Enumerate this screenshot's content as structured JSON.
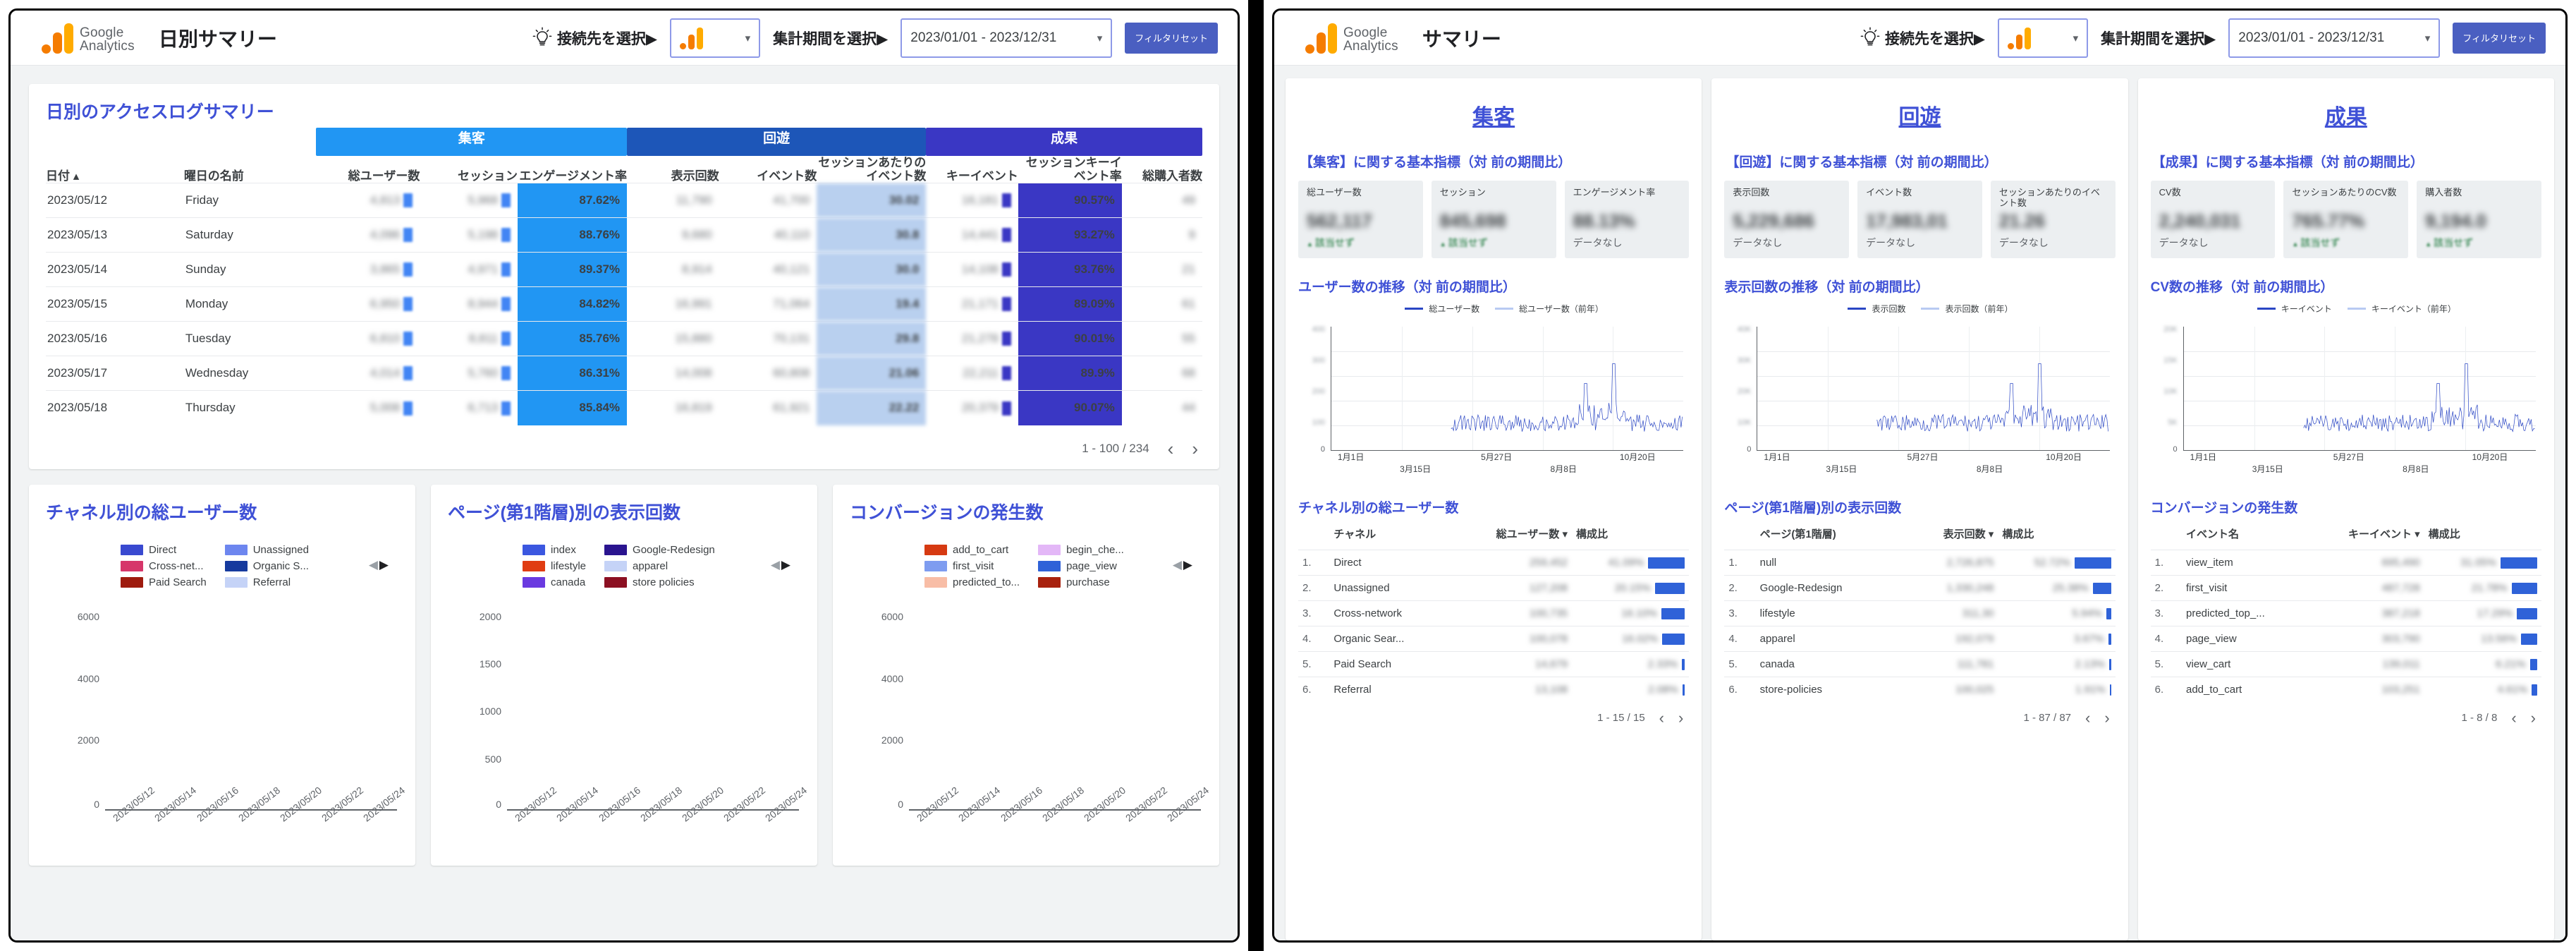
{
  "left": {
    "topbar": {
      "brand_line1": "Google",
      "brand_line2": "Analytics",
      "doc_title": "日別サマリー",
      "connect_label": "接続先を選択▶",
      "period_label": "集計期間を選択▶",
      "date_range": "2023/01/01 - 2023/12/31",
      "reset_label": "フィルタリセット",
      "dropdown_caret": "▾"
    },
    "table_card": {
      "title": "日別のアクセスログサマリー",
      "groups": [
        {
          "label": "集客",
          "color": "#2196f3",
          "span": 3
        },
        {
          "label": "回遊",
          "color": "#1d56b8",
          "span": 3
        },
        {
          "label": "成果",
          "color": "#3a37c4",
          "span": 3
        }
      ],
      "columns": [
        "日付 ▴",
        "曜日の名前",
        "総ユーザー数",
        "セッション",
        "エンゲージメント率",
        "表示回数",
        "イベント数",
        "セッションあたりのイベント数",
        "キーイベント",
        "セッションキーイベント率",
        "総購入者数"
      ],
      "rows": [
        {
          "date": "2023/05/12",
          "weekday": "Friday",
          "engagement": "87.62%",
          "event_per_session": "30.02",
          "key_event_rate": "90.57%"
        },
        {
          "date": "2023/05/13",
          "weekday": "Saturday",
          "engagement": "88.76%",
          "event_per_session": "30.8",
          "key_event_rate": "93.27%"
        },
        {
          "date": "2023/05/14",
          "weekday": "Sunday",
          "engagement": "89.37%",
          "event_per_session": "30.0",
          "key_event_rate": "93.76%"
        },
        {
          "date": "2023/05/15",
          "weekday": "Monday",
          "engagement": "84.82%",
          "event_per_session": "19.4",
          "key_event_rate": "89.09%"
        },
        {
          "date": "2023/05/16",
          "weekday": "Tuesday",
          "engagement": "85.76%",
          "event_per_session": "29.8",
          "key_event_rate": "90.01%"
        },
        {
          "date": "2023/05/17",
          "weekday": "Wednesday",
          "engagement": "86.31%",
          "event_per_session": "21.06",
          "key_event_rate": "89.9%"
        },
        {
          "date": "2023/05/18",
          "weekday": "Thursday",
          "engagement": "85.84%",
          "event_per_session": "22.22",
          "key_event_rate": "90.07%"
        }
      ],
      "pager": {
        "range": "1 - 100 / 234",
        "prev": "‹",
        "next": "›"
      }
    },
    "charts": [
      {
        "title": "チャネル別の総ユーザー数",
        "legend": [
          {
            "label": "Direct",
            "color": "#3949d0"
          },
          {
            "label": "Unassigned",
            "color": "#6d86ef"
          },
          {
            "label": "Cross-net...",
            "color": "#d6366a"
          },
          {
            "label": "Organic S...",
            "color": "#163a9e"
          },
          {
            "label": "Paid Search",
            "color": "#9e1b0e"
          },
          {
            "label": "Referral",
            "color": "#c5d3f7"
          }
        ],
        "yticks": [
          "6000",
          "4000",
          "2000",
          "0"
        ],
        "xlabels": [
          "2023/05/12",
          "2023/05/14",
          "2023/05/16",
          "2023/05/18",
          "2023/05/20",
          "2023/05/22",
          "2023/05/24"
        ]
      },
      {
        "title": "ページ(第1階層)別の表示回数",
        "legend": [
          {
            "label": "index",
            "color": "#3b57e0"
          },
          {
            "label": "Google-Redesign",
            "color": "#2a148f"
          },
          {
            "label": "lifestyle",
            "color": "#e03c12"
          },
          {
            "label": "apparel",
            "color": "#c5d3f7"
          },
          {
            "label": "canada",
            "color": "#6a3ae0"
          },
          {
            "label": "store policies",
            "color": "#8c1022"
          }
        ],
        "yticks": [
          "2000",
          "1500",
          "1000",
          "500",
          "0"
        ],
        "xlabels": [
          "2023/05/12",
          "2023/05/14",
          "2023/05/16",
          "2023/05/18",
          "2023/05/20",
          "2023/05/22",
          "2023/05/24"
        ]
      },
      {
        "title": "コンバージョンの発生数",
        "legend": [
          {
            "label": "add_to_cart",
            "color": "#d63a12"
          },
          {
            "label": "begin_che...",
            "color": "#e3b7f7"
          },
          {
            "label": "first_visit",
            "color": "#7e9cf0"
          },
          {
            "label": "page_view",
            "color": "#2f62d8"
          },
          {
            "label": "predicted_to...",
            "color": "#f8bda6"
          },
          {
            "label": "purchase",
            "color": "#a8210e"
          }
        ],
        "yticks": [
          "6000",
          "4000",
          "2000",
          "0"
        ],
        "xlabels": [
          "2023/05/12",
          "2023/05/14",
          "2023/05/16",
          "2023/05/18",
          "2023/05/20",
          "2023/05/22",
          "2023/05/24"
        ]
      }
    ],
    "legend_nav": {
      "left": "◀",
      "right": "▶"
    }
  },
  "right": {
    "topbar": {
      "brand_line1": "Google",
      "brand_line2": "Analytics",
      "doc_title": "サマリー",
      "connect_label": "接続先を選択▶",
      "period_label": "集計期間を選択▶",
      "date_range": "2023/01/01 - 2023/12/31",
      "reset_label": "フィルタリセット",
      "dropdown_caret": "▾"
    },
    "columns": [
      {
        "heading": "集客",
        "kpi_section_title": "【集客】に関する基本指標（対 前の期間比）",
        "kpis": [
          {
            "label": "総ユーザー数",
            "value": "562,117",
            "delta": "該当せず",
            "delta_kind": "up"
          },
          {
            "label": "セッション",
            "value": "845,698",
            "delta": "該当せず",
            "delta_kind": "up"
          },
          {
            "label": "エンゲージメント率",
            "value": "88.13%",
            "delta": "データなし",
            "delta_kind": "none"
          }
        ],
        "trend": {
          "title": "ユーザー数の推移（対 前の期間比）",
          "legend": [
            {
              "label": "総ユーザー数",
              "color": "#2a46c4"
            },
            {
              "label": "総ユーザー数（前年）",
              "color": "#b8caf2"
            }
          ],
          "yticks": [
            "400",
            "300",
            "200",
            "100",
            "0"
          ],
          "xlabels": [
            "1月1日",
            "3月15日",
            "5月27日",
            "8月8日",
            "10月20日"
          ]
        },
        "table": {
          "title": "チャネル別の総ユーザー数",
          "columns": [
            "チャネル",
            "総ユーザー数 ▾",
            "構成比"
          ],
          "rows": [
            {
              "idx": "1.",
              "name": "Direct",
              "value": "259,452",
              "pct": "41.09%",
              "bar": 100
            },
            {
              "idx": "2.",
              "name": "Unassigned",
              "value": "127,208",
              "pct": "20.15%",
              "bar": 82
            },
            {
              "idx": "3.",
              "name": "Cross-network",
              "value": "100,735",
              "pct": "16.10%",
              "bar": 64
            },
            {
              "idx": "4.",
              "name": "Organic Sear...",
              "value": "100,078",
              "pct": "16.02%",
              "bar": 62
            },
            {
              "idx": "5.",
              "name": "Paid Search",
              "value": "14,679",
              "pct": "2.33%",
              "bar": 8
            },
            {
              "idx": "6.",
              "name": "Referral",
              "value": "13,108",
              "pct": "2.08%",
              "bar": 7
            }
          ],
          "pager": {
            "range": "1 - 15 / 15",
            "prev": "‹",
            "next": "›"
          }
        }
      },
      {
        "heading": "回遊",
        "kpi_section_title": "【回遊】に関する基本指標（対 前の期間比）",
        "kpis": [
          {
            "label": "表示回数",
            "value": "5,229,686",
            "delta": "データなし",
            "delta_kind": "none"
          },
          {
            "label": "イベント数",
            "value": "17,983,01",
            "delta": "データなし",
            "delta_kind": "none"
          },
          {
            "label": "セッションあたりのイベント数",
            "value": "21.26",
            "delta": "データなし",
            "delta_kind": "none"
          }
        ],
        "trend": {
          "title": "表示回数の推移（対 前の期間比）",
          "legend": [
            {
              "label": "表示回数",
              "color": "#2a46c4"
            },
            {
              "label": "表示回数（前年）",
              "color": "#b8caf2"
            }
          ],
          "yticks": [
            "40K",
            "30K",
            "20K",
            "10K",
            "0"
          ],
          "xlabels": [
            "1月1日",
            "3月15日",
            "5月27日",
            "8月8日",
            "10月20日"
          ]
        },
        "table": {
          "title": "ページ(第1階層)別の表示回数",
          "columns": [
            "ページ(第1階層)",
            "表示回数 ▾",
            "構成比"
          ],
          "rows": [
            {
              "idx": "1.",
              "name": "null",
              "value": "2,726,875",
              "pct": "52.72%",
              "bar": 100
            },
            {
              "idx": "2.",
              "name": "Google-Redesign",
              "value": "1,330,248",
              "pct": "25.38%",
              "bar": 50
            },
            {
              "idx": "3.",
              "name": "lifestyle",
              "value": "311,30",
              "pct": "5.94%",
              "bar": 13
            },
            {
              "idx": "4.",
              "name": "apparel",
              "value": "192,079",
              "pct": "3.67%",
              "bar": 8
            },
            {
              "idx": "5.",
              "name": "canada",
              "value": "111,781",
              "pct": "2.13%",
              "bar": 5
            },
            {
              "idx": "6.",
              "name": "store-policies",
              "value": "100,025",
              "pct": "1.91%",
              "bar": 4
            }
          ],
          "pager": {
            "range": "1 - 87 / 87",
            "prev": "‹",
            "next": "›"
          }
        }
      },
      {
        "heading": "成果",
        "kpi_section_title": "【成果】に関する基本指標（対 前の期間比）",
        "kpis": [
          {
            "label": "CV数",
            "value": "2,240,031",
            "delta": "データなし",
            "delta_kind": "none"
          },
          {
            "label": "セッションあたりのCV数",
            "value": "765.77%",
            "delta": "該当せず",
            "delta_kind": "up"
          },
          {
            "label": "購入者数",
            "value": "9,194.0",
            "delta": "該当せず",
            "delta_kind": "up"
          }
        ],
        "trend": {
          "title": "CV数の推移（対 前の期間比）",
          "legend": [
            {
              "label": "キーイベント",
              "color": "#2a46c4"
            },
            {
              "label": "キーイベント（前年）",
              "color": "#b8caf2"
            }
          ],
          "yticks": [
            "20K",
            "15K",
            "10K",
            "5K",
            "0"
          ],
          "xlabels": [
            "1月1日",
            "3月15日",
            "5月27日",
            "8月8日",
            "10月20日"
          ]
        },
        "table": {
          "title": "コンバージョンの発生数",
          "columns": [
            "イベント名",
            "キーイベント ▾",
            "構成比"
          ],
          "rows": [
            {
              "idx": "1.",
              "name": "view_item",
              "value": "695,490",
              "pct": "31.05%",
              "bar": 100
            },
            {
              "idx": "2.",
              "name": "first_visit",
              "value": "487,728",
              "pct": "21.78%",
              "bar": 70
            },
            {
              "idx": "3.",
              "name": "predicted_top_...",
              "value": "387,218",
              "pct": "17.29%",
              "bar": 55
            },
            {
              "idx": "4.",
              "name": "page_view",
              "value": "303,790",
              "pct": "13.56%",
              "bar": 44
            },
            {
              "idx": "5.",
              "name": "view_cart",
              "value": "139,011",
              "pct": "6.21%",
              "bar": 20
            },
            {
              "idx": "6.",
              "name": "add_to_cart",
              "value": "103,251",
              "pct": "4.61%",
              "bar": 15
            }
          ],
          "pager": {
            "range": "1 - 8 / 8",
            "prev": "‹",
            "next": "›"
          }
        }
      }
    ]
  }
}
